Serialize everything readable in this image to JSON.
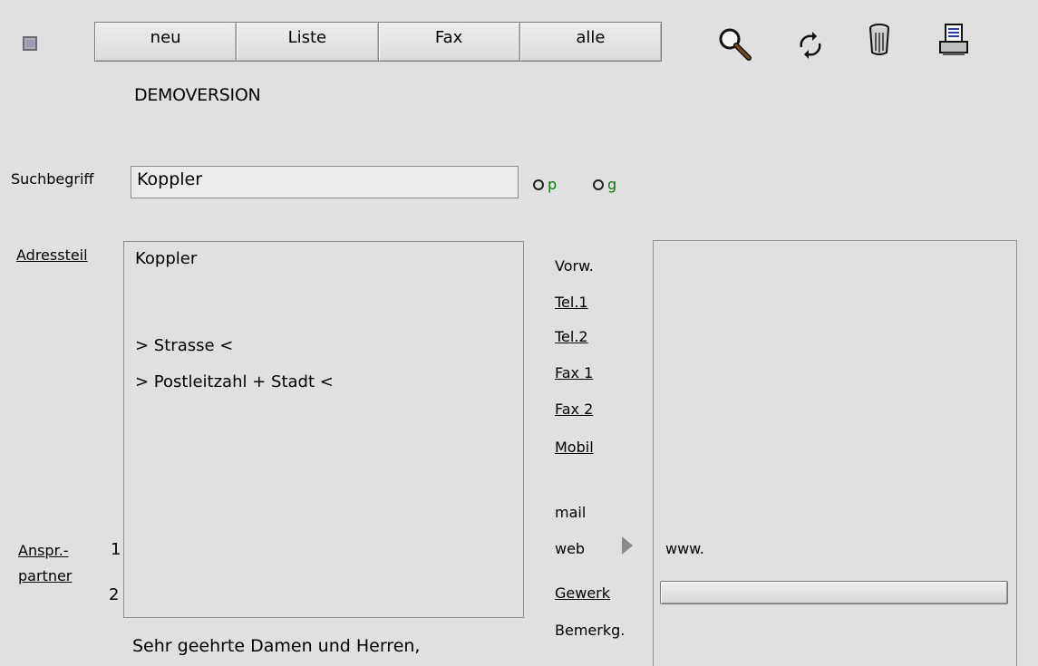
{
  "toolbar": {
    "buttons": [
      "neu",
      "Liste",
      "Fax",
      "alle"
    ],
    "icons": [
      "search-icon",
      "refresh-icon",
      "trash-icon",
      "print-icon"
    ]
  },
  "header": {
    "demo": "DEMOVERSION"
  },
  "search": {
    "label": "Suchbegriff",
    "value": "Koppler",
    "radio1_letter": "p",
    "radio2_letter": "g"
  },
  "left_links": {
    "adressteil": "Adressteil",
    "anspr_line1": "Anspr.-",
    "anspr_line2": "partner",
    "num1": "1",
    "num2": "2"
  },
  "address": {
    "name": "Koppler",
    "street": "> Strasse <",
    "city": "> Postleitzahl + Stadt <"
  },
  "right_labels": {
    "vorw": "Vorw.",
    "tel1": "Tel.1",
    "tel2": "Tel.2",
    "fax1": "Fax 1",
    "fax2": "Fax 2",
    "mobil": "Mobil",
    "mail": "mail",
    "web": "web",
    "gewerk": "Gewerk",
    "bemerkg": "Bemerkg."
  },
  "web_value": "www.",
  "greeting": "Sehr geehrte Damen und Herren,"
}
